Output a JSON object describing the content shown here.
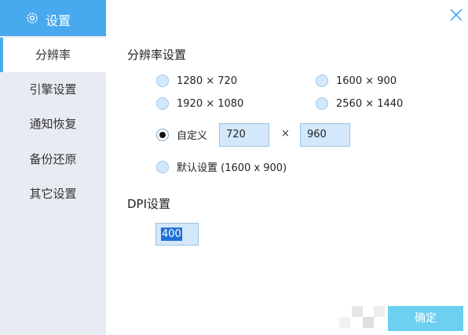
{
  "sidebar": {
    "title": "设置",
    "icon": "gear-icon",
    "items": [
      {
        "label": "分辨率",
        "active": true
      },
      {
        "label": "引擎设置",
        "active": false
      },
      {
        "label": "通知恢复",
        "active": false
      },
      {
        "label": "备份还原",
        "active": false
      },
      {
        "label": "其它设置",
        "active": false
      }
    ]
  },
  "resolution": {
    "title": "分辨率设置",
    "options": [
      {
        "label": "1280 × 720",
        "selected": false
      },
      {
        "label": "1600 × 900",
        "selected": false
      },
      {
        "label": "1920 × 1080",
        "selected": false
      },
      {
        "label": "2560 × 1440",
        "selected": false
      }
    ],
    "custom": {
      "label": "自定义",
      "selected": true,
      "width": "720",
      "height": "960",
      "separator": "×"
    },
    "default": {
      "label": "默认设置 (1600 x 900)",
      "selected": false
    }
  },
  "dpi": {
    "title": "DPI设置",
    "value": "400"
  },
  "footer": {
    "confirm_label": "确定"
  },
  "colors": {
    "accent": "#49a9ee",
    "sidebar_bg": "#e9ebf3",
    "field_bg": "#d3e8fa",
    "confirm_bg": "#6dd0f0"
  }
}
